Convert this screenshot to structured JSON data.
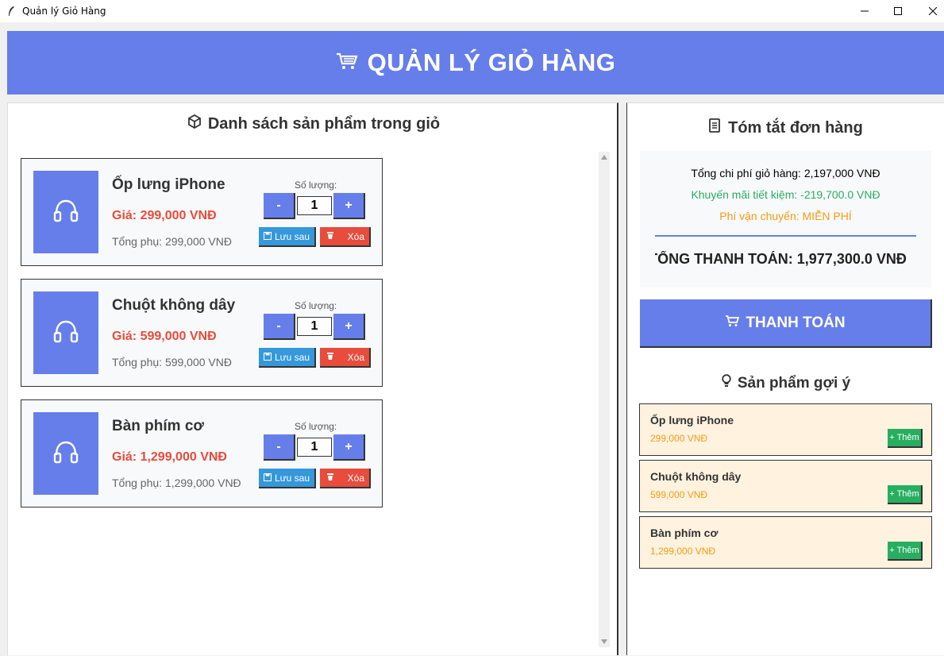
{
  "window": {
    "title": "Quản lý Giỏ Hàng",
    "icon": "feather-icon"
  },
  "header": {
    "title": "QUẢN LÝ GIỎ HÀNG",
    "icon": "cart-icon",
    "color": "#667eea"
  },
  "cart": {
    "title": "Danh sách sản phẩm trong giỏ",
    "qty_label": "Số lượng:",
    "minus_label": "-",
    "plus_label": "+",
    "save_label": "Lưu sau",
    "delete_label": "Xóa",
    "items": [
      {
        "name": "Ốp lưng iPhone",
        "price": "Giá: 299,000 VNĐ",
        "subtotal": "Tổng phụ: 299,000 VNĐ",
        "quantity": "1",
        "icon": "headphones-icon"
      },
      {
        "name": "Chuột không dây",
        "price": "Giá: 599,000 VNĐ",
        "subtotal": "Tổng phụ: 599,000 VNĐ",
        "quantity": "1",
        "icon": "headphones-icon"
      },
      {
        "name": "Bàn phím cơ",
        "price": "Giá: 1,299,000 VNĐ",
        "subtotal": "Tổng phụ: 1,299,000 VNĐ",
        "quantity": "1",
        "icon": "headphones-icon"
      }
    ]
  },
  "summary": {
    "title": "Tóm tắt đơn hàng",
    "cart_total": "Tổng chi phí giỏ hàng: 2,197,000 VNĐ",
    "discount": "Khuyến mãi tiết kiệm: -219,700.0 VNĐ",
    "shipping": "Phí vận chuyển: MIỄN PHÍ",
    "grand_total": "TỔNG THANH TOÁN: 1,977,300.0 VNĐ",
    "checkout_label": "THANH TOÁN"
  },
  "suggestions": {
    "title": "Sản phẩm gợi ý",
    "add_label": "+ Thêm",
    "items": [
      {
        "name": "Ốp lưng iPhone",
        "price": "299,000 VNĐ"
      },
      {
        "name": "Chuột không dây",
        "price": "599,000 VNĐ"
      },
      {
        "name": "Bàn phím cơ",
        "price": "1,299,000 VNĐ"
      }
    ]
  },
  "colors": {
    "accent": "#667eea",
    "price": "#e74c3c",
    "save": "#3498db",
    "delete": "#e74c3c",
    "discount": "#27ae60",
    "shipping": "#f39c12",
    "add": "#27ae60",
    "suggestion_bg": "#fff3e0"
  }
}
